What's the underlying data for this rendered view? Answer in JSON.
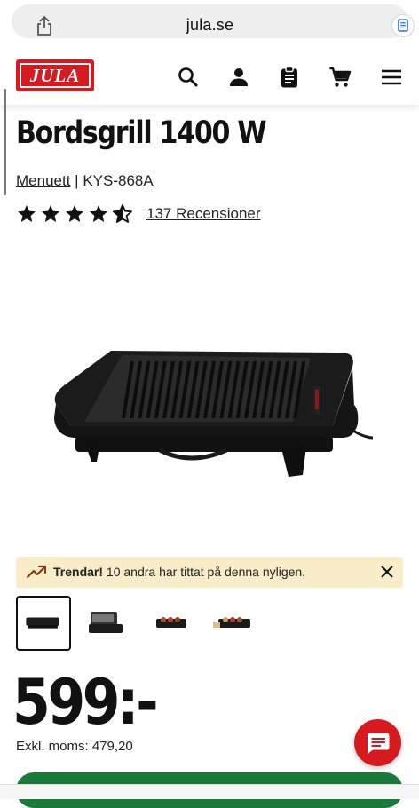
{
  "browser": {
    "url": "jula.se"
  },
  "header": {
    "logo_text": "JULA",
    "icons": [
      "search-icon",
      "account-icon",
      "clipboard-list-icon",
      "cart-icon",
      "hamburger-menu-icon"
    ]
  },
  "product": {
    "title": "Bordsgrill 1400 W",
    "brand": "Menuett",
    "separator": "|",
    "model": "KYS-868A",
    "rating": 4.5,
    "rating_max": 5,
    "reviews": "137 Recensioner",
    "image_icon": "table-grill-image",
    "thumbnails": 4,
    "selected_thumbnail": 1
  },
  "trend_banner": {
    "label": "Trendar!",
    "text": "10 andra har tittat på denna nyligen."
  },
  "pricing": {
    "price": "599:-",
    "excl_vat": "Exkl. moms: 479,20"
  },
  "colors": {
    "brand_red": "#d71920",
    "banner_bg": "#f9ecc9",
    "cta_green": "#1a7a3a"
  }
}
